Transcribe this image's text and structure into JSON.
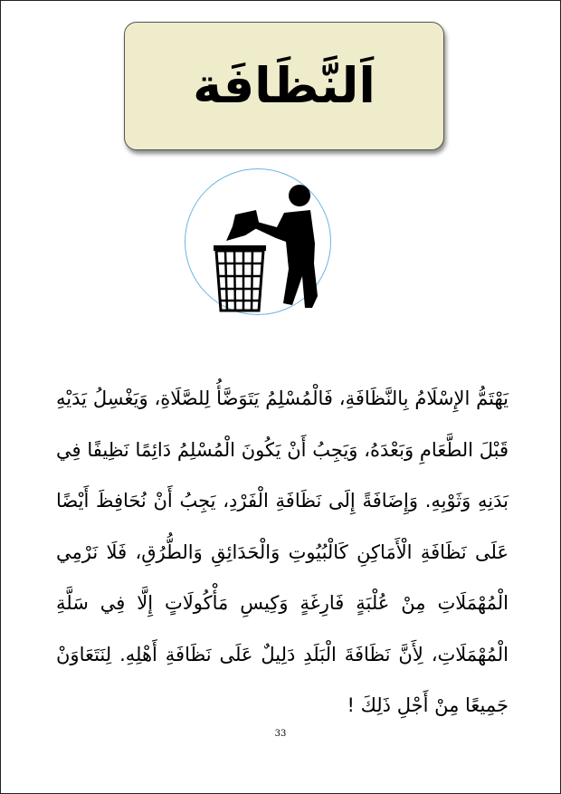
{
  "title": "اَلنَّظَافَة",
  "illustration": {
    "icon": "trash-bin-person-icon",
    "circle_color": "#6cb4e4",
    "box_color": "#eeeccb"
  },
  "body": "يَهْتَمُّ الإِسْلَامُ بِالنَّظَافَةِ، فَالْمُسْلِمُ يَتَوَضَّأُ لِلصَّلَاةِ، وَيَغْسِلُ يَدَيْهِ قَبْلَ الطَّعَامِ وَبَعْدَهُ، وَيَجِبُ أَنْ يَكُونَ الْمُسْلِمُ دَائِمًا نَظِيفًا فِي بَدَنِهِ وَثَوْبِهِ. وَإِضَافَةً إِلَى نَظَافَةِ الْفَرْدِ، يَجِبُ أَنْ نُحَافِظَ أَيْضًا عَلَى نَظَافَةِ الْأَمَاكِنِ كَالْبُيُوتِ وَالْحَدَائِقِ وَالطُّرُقِ، فَلَا نَرْمِي الْمُهْمَلَاتِ مِنْ عُلْبَةٍ فَارِغَةٍ وَكِيسِ مَأْكُولَاتٍ إِلَّا فِي سَلَّةِ الْمُهْمَلَاتِ، لِأَنَّ نَظَافَةَ الْبَلَدِ دَلِيلٌ عَلَى نَظَافَةِ أَهْلِهِ. لِنَتَعَاوَنْ جَمِيعًا مِنْ أَجْلِ ذَلِكَ !",
  "page_number": "33"
}
